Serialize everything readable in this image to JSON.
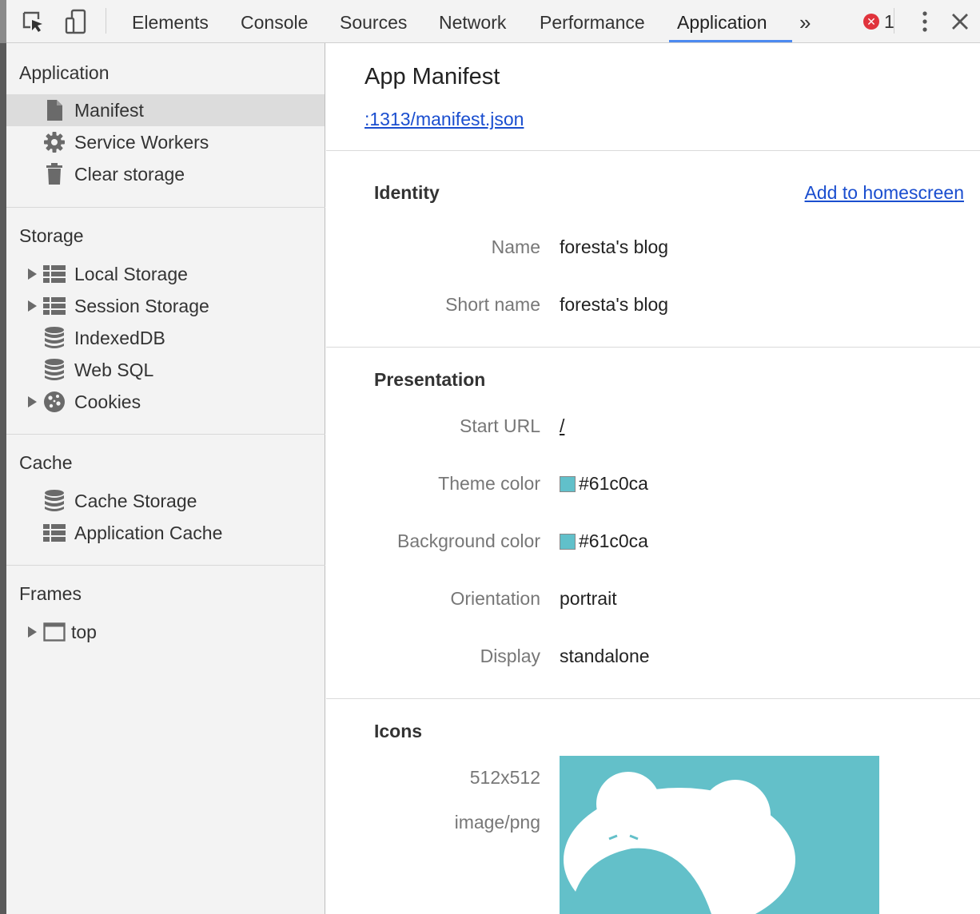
{
  "toolbar": {
    "tabs": [
      {
        "label": "Elements"
      },
      {
        "label": "Console"
      },
      {
        "label": "Sources"
      },
      {
        "label": "Network"
      },
      {
        "label": "Performance"
      },
      {
        "label": "Application"
      }
    ],
    "active_tab": "Application",
    "more_tabs": "»",
    "error_count": "1",
    "accent_color": "#4c8af0",
    "error_color": "#e0333c"
  },
  "sidebar": {
    "application": {
      "title": "Application",
      "items": [
        {
          "label": "Manifest",
          "icon": "document-icon",
          "selected": true
        },
        {
          "label": "Service Workers",
          "icon": "gear-icon"
        },
        {
          "label": "Clear storage",
          "icon": "trash-icon"
        }
      ]
    },
    "storage": {
      "title": "Storage",
      "items": [
        {
          "label": "Local Storage",
          "icon": "grid-icon",
          "expandable": true
        },
        {
          "label": "Session Storage",
          "icon": "grid-icon",
          "expandable": true
        },
        {
          "label": "IndexedDB",
          "icon": "database-icon"
        },
        {
          "label": "Web SQL",
          "icon": "database-icon"
        },
        {
          "label": "Cookies",
          "icon": "cookie-icon",
          "expandable": true
        }
      ]
    },
    "cache": {
      "title": "Cache",
      "items": [
        {
          "label": "Cache Storage",
          "icon": "database-icon"
        },
        {
          "label": "Application Cache",
          "icon": "grid-icon"
        }
      ]
    },
    "frames": {
      "title": "Frames",
      "items": [
        {
          "label": "top",
          "icon": "frame-icon",
          "expandable": true
        }
      ]
    }
  },
  "main": {
    "title": "App Manifest",
    "manifest_link": ":1313/manifest.json",
    "identity": {
      "title": "Identity",
      "action": "Add to homescreen",
      "rows": [
        {
          "label": "Name",
          "value": "foresta's blog"
        },
        {
          "label": "Short name",
          "value": "foresta's blog"
        }
      ]
    },
    "presentation": {
      "title": "Presentation",
      "start_url_label": "Start URL",
      "start_url_value": "/",
      "theme_color_label": "Theme color",
      "theme_color_value": "#61c0ca",
      "background_color_label": "Background color",
      "background_color_value": "#61c0ca",
      "orientation_label": "Orientation",
      "orientation_value": "portrait",
      "display_label": "Display",
      "display_value": "standalone"
    },
    "icons": {
      "title": "Icons",
      "size": "512x512",
      "type": "image/png",
      "preview_bg": "#63c0c9"
    }
  }
}
